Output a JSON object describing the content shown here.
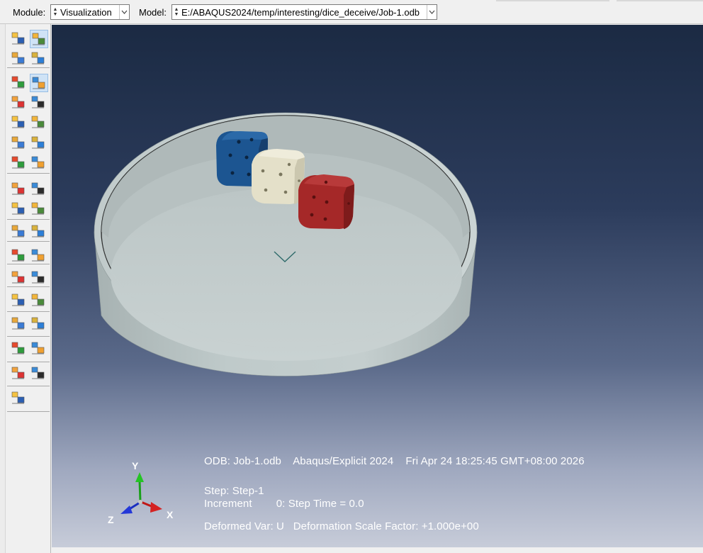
{
  "context_bar": {
    "module_label": "Module:",
    "module_value": "Visualization",
    "model_label": "Model:",
    "model_value": "E:/ABAQUS2024/temp/interesting/dice_deceive/Job-1.odb"
  },
  "toolbox": {
    "icons": [
      "plot-undeformed-icon",
      "plot-deformed-icon",
      "common-options-icon",
      "superimpose-options-icon",
      "plot-contours-icon",
      "contour-options-icon",
      "plot-symbols-icon",
      "symbol-options-icon",
      "plot-material-orientations-icon",
      "orientation-options-icon",
      "allow-multiple-plot-states-icon",
      "plot-states-options-icon",
      "animate-time-history-icon",
      "animate-scale-factor-icon",
      "animate-harmonic-icon",
      "animation-options-icon",
      "create-display-group-icon",
      "display-group-manager-icon",
      "create-xy-data-icon",
      "xy-data-manager-icon",
      "create-path-icon",
      "xy-plot-icon",
      "create-free-body-icon",
      "free-body-manager-icon",
      "view-cut-icon",
      "view-cut-manager-icon",
      "stream-icon",
      "stream-manager-icon",
      "active-steps-icon",
      "report-field-output-icon",
      "copy-data-icon",
      "data-manager-icon",
      "query-tool-icon"
    ]
  },
  "viewport": {
    "odb_line": "ODB: Job-1.odb    Abaqus/Explicit 2024    Fri Apr 24 18:25:45 GMT+08:00 2026",
    "step_line": "Step: Step-1",
    "increment_line": "Increment        0: Step Time = 0.0",
    "deformed_line": "Deformed Var: U   Deformation Scale Factor: +1.000e+00",
    "triad": {
      "y": "Y",
      "x": "X",
      "z": "Z"
    }
  },
  "colors": {
    "dice_blue": "#1e5a9a",
    "dice_white": "#e6e2cc",
    "dice_red": "#a82a2a",
    "bowl": "#b9c3c3"
  }
}
